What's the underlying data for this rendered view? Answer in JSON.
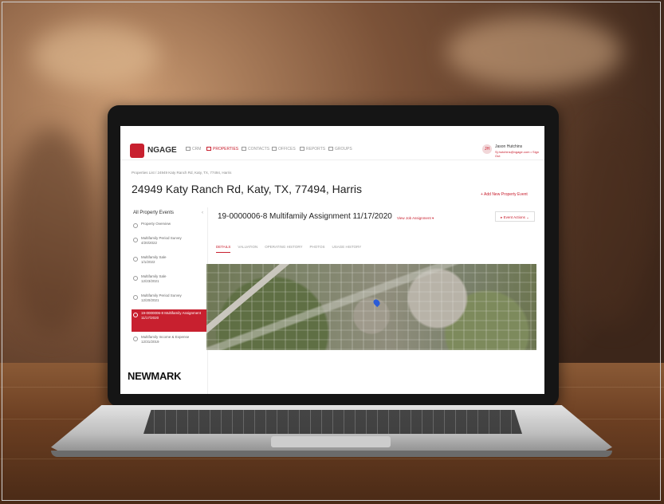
{
  "app": {
    "logo_text": "NGAGE",
    "nav": [
      {
        "label": "CRM",
        "active": false
      },
      {
        "label": "PROPERTIES",
        "active": true
      },
      {
        "label": "CONTACTS",
        "active": false
      },
      {
        "label": "OFFICES",
        "active": false
      },
      {
        "label": "REPORTS",
        "active": false
      },
      {
        "label": "GROUPS",
        "active": false
      }
    ],
    "user": {
      "initials": "JH",
      "name": "Jason Hutchins",
      "sub": "Sj.hutchins@ngage.com • Sign Out"
    }
  },
  "page": {
    "breadcrumb": "Properties List / 24949 Katy Ranch Rd, Katy, TX, 77494, Harris",
    "address": "24949 Katy Ranch Rd, Katy, TX, 77494, Harris",
    "add_event_label": "+ Add New Property Event"
  },
  "sidebar": {
    "title": "All Property Events",
    "items": [
      {
        "label": "Property Overview",
        "date": "",
        "active": false
      },
      {
        "label": "Multifamily Period Survey",
        "date": "4/20/2022",
        "active": false
      },
      {
        "label": "Multifamily Sale",
        "date": "1/1/2022",
        "active": false
      },
      {
        "label": "Multifamily Sale",
        "date": "12/23/2021",
        "active": false
      },
      {
        "label": "Multifamily Period Survey",
        "date": "12/20/2021",
        "active": false
      },
      {
        "label": "19-0000006-8 Multifamily Assignment",
        "date": "11/17/2020",
        "active": true
      },
      {
        "label": "Multifamily Income & Expense",
        "date": "12/31/2019",
        "active": false
      }
    ]
  },
  "assignment": {
    "title": "19-0000006-8 Multifamily Assignment 11/17/2020",
    "link": "View Job Assignment ▾",
    "actions": "▸ Event Actions ⌄",
    "tabs": [
      {
        "label": "DETAILS",
        "active": true
      },
      {
        "label": "VALUATION",
        "active": false
      },
      {
        "label": "OPERATING HISTORY",
        "active": false
      },
      {
        "label": "PHOTOS",
        "active": false
      },
      {
        "label": "USAGE HISTORY",
        "active": false
      }
    ]
  },
  "brand": "NEWMARK",
  "colors": {
    "accent": "#c8202f"
  }
}
